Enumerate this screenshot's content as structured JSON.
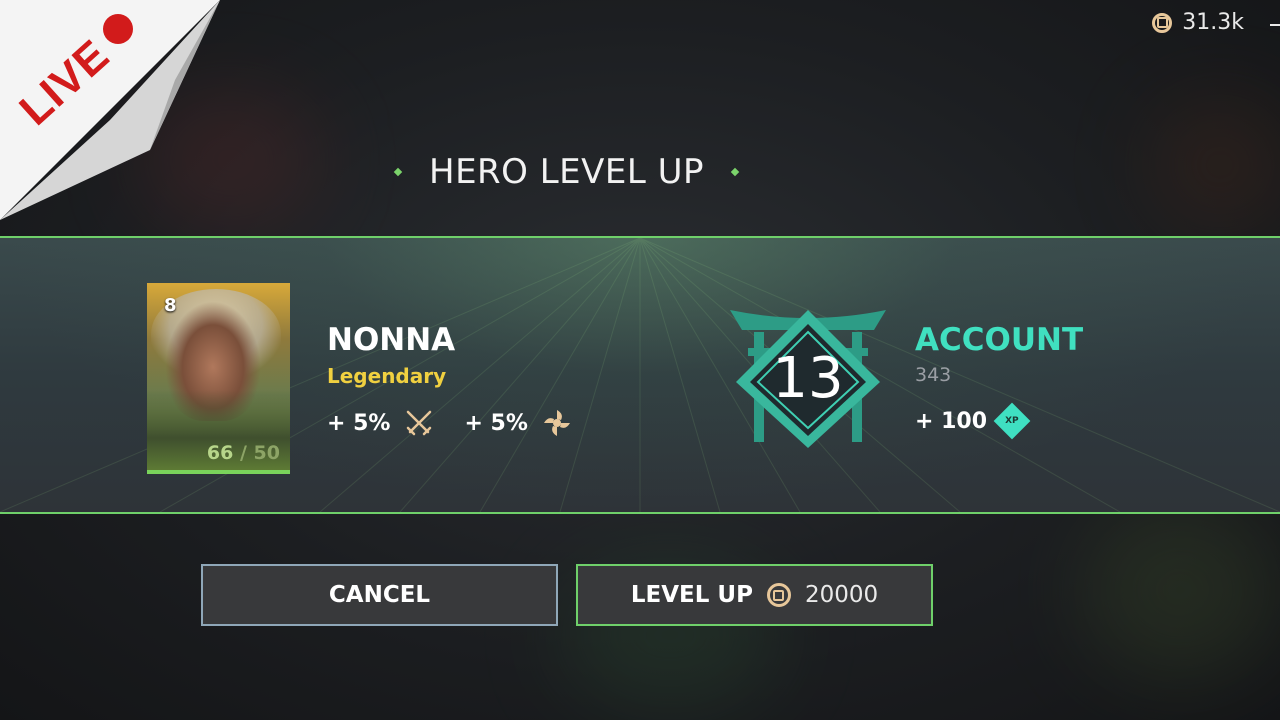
{
  "live_badge": {
    "text": "LIVE"
  },
  "currency": {
    "icon": "coin-icon",
    "value": "31.3k"
  },
  "title": "HERO LEVEL UP",
  "hero": {
    "rank": "8",
    "level_current": "66",
    "level_separator": " / ",
    "level_cap": "50",
    "name": "NONNA",
    "rarity": "Legendary",
    "bonuses": [
      {
        "text": "+ 5%",
        "icon": "swords-icon"
      },
      {
        "text": "+ 5%",
        "icon": "vortex-icon"
      }
    ]
  },
  "account": {
    "level": "13",
    "label": "ACCOUNT",
    "xp_total": "343",
    "xp_gain": "+ 100",
    "xp_icon_label": "XP"
  },
  "buttons": {
    "cancel": "CANCEL",
    "level_up": "LEVEL UP",
    "level_up_cost": "20000"
  },
  "colors": {
    "accent_green": "#6fd06a",
    "account_teal": "#40e0c0",
    "legendary_yellow": "#f0d040",
    "live_red": "#d21b1b"
  }
}
